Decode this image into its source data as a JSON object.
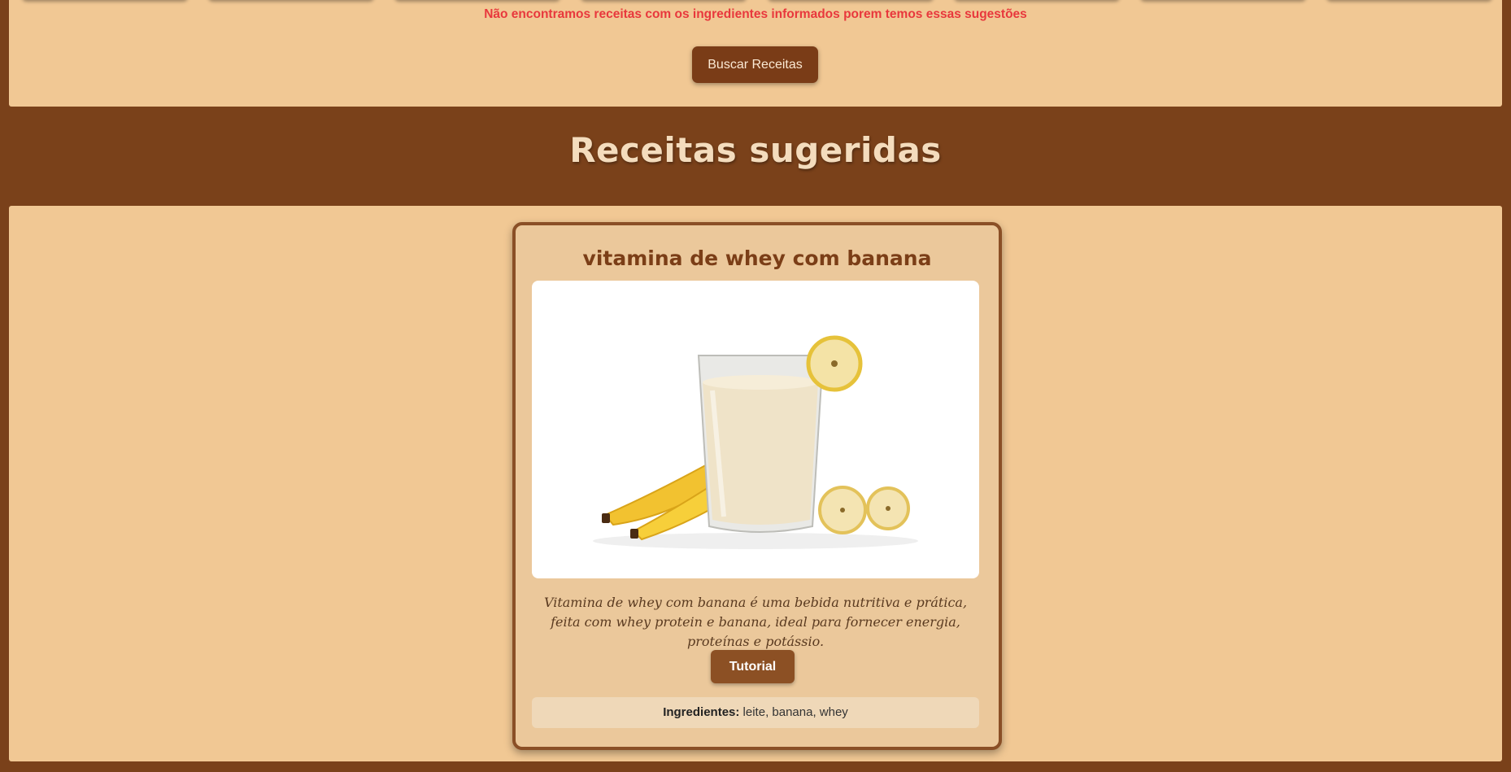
{
  "search": {
    "warning": "Não encontramos receitas com os ingredientes informados porem temos essas sugestões",
    "button_label": "Buscar Receitas"
  },
  "section": {
    "title": "Receitas sugeridas"
  },
  "recipe": {
    "title": "vitamina de whey com banana",
    "image_alt": "vitamina de whey com banana",
    "description": "Vitamina de whey com banana é uma bebida nutritiva e prática, feita com whey protein e banana, ideal para fornecer energia, proteínas e potássio.",
    "tutorial_label": "Tutorial",
    "ingredients_label": "Ingredientes:",
    "ingredients": "leite, banana, whey"
  },
  "colors": {
    "background": "#7a411a",
    "panel": "#f1c894",
    "card": "#ebc89b",
    "accent": "#7a3c17",
    "warning": "#e8383d"
  }
}
